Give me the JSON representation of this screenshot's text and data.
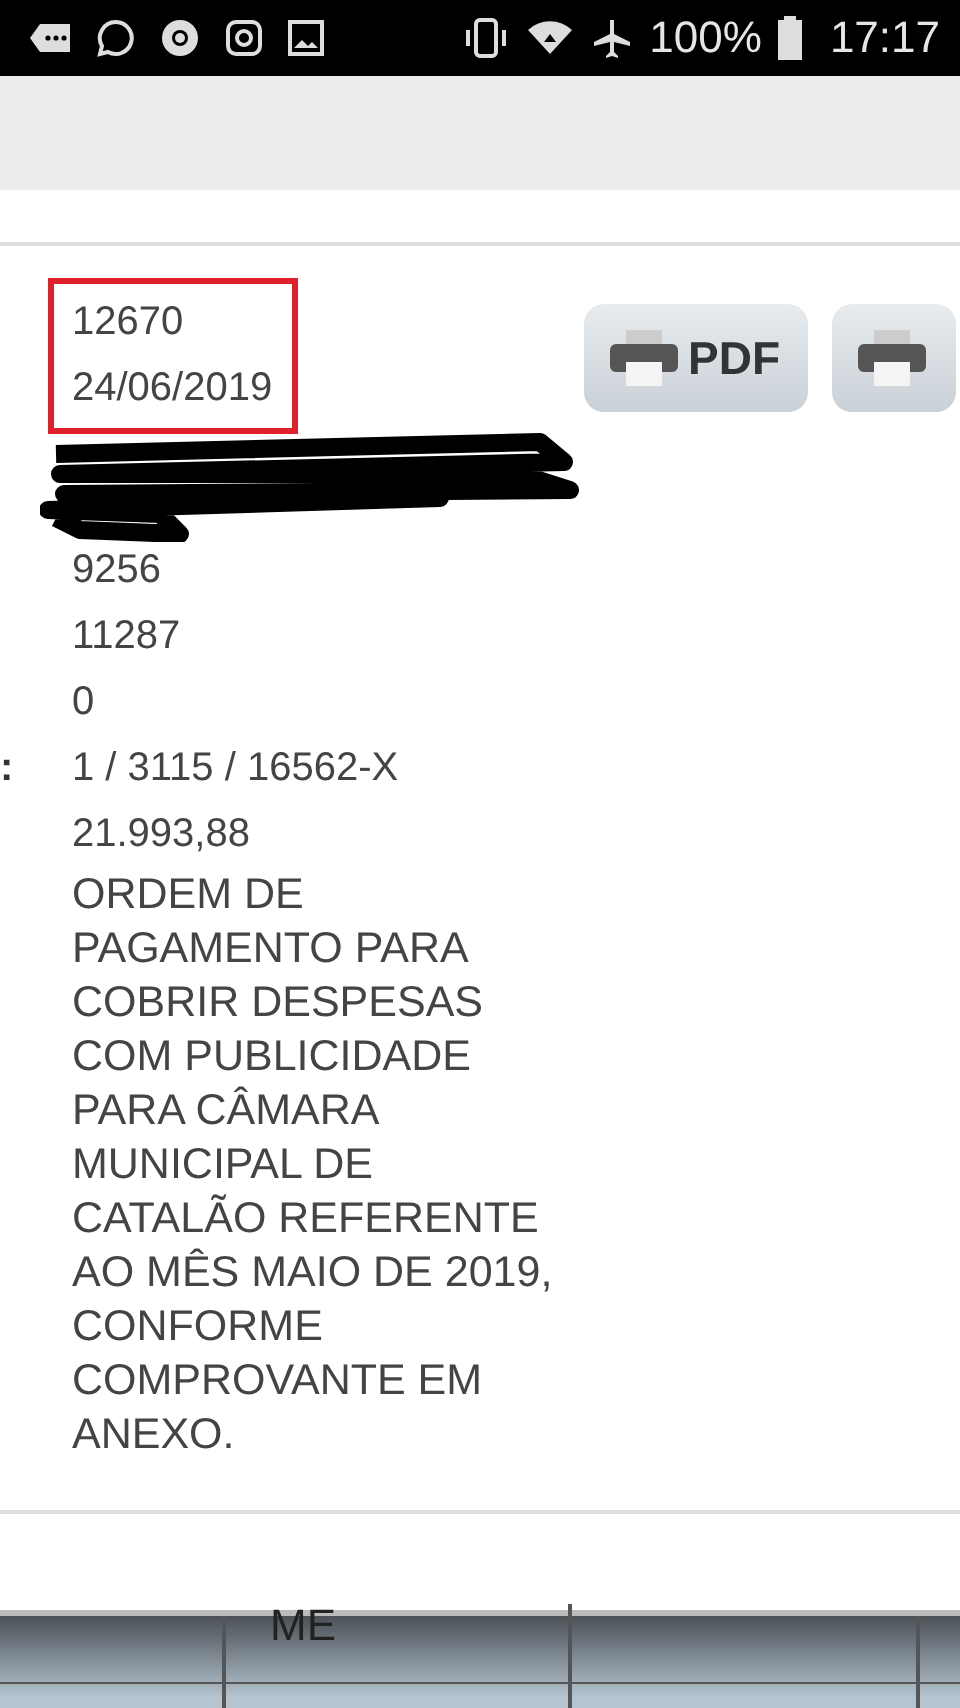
{
  "status_bar": {
    "battery": "100%",
    "time": "17:17"
  },
  "record": {
    "number": "12670",
    "date": "24/06/2019",
    "values": [
      "9256",
      "11287",
      "0"
    ],
    "account_label_tail": ":",
    "account": "1 / 3115 / 16562-X",
    "amount": "21.993,88",
    "description": "ORDEM DE PAGAMENTO PARA COBRIR DESPESAS COM PUBLICIDADE PARA CÂMARA MUNICIPAL DE CATALÃO REFERENTE AO MÊS MAIO DE 2019, CONFORME COMPROVANTE EM ANEXO."
  },
  "buttons": [
    {
      "kind": "print",
      "label": "PDF"
    },
    {
      "kind": "print"
    }
  ],
  "table": {
    "cell": "ME"
  }
}
